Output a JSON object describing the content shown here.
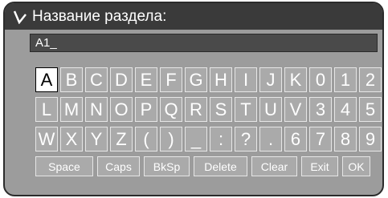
{
  "title": {
    "text": "Название раздела:",
    "icon": "chevron-down-icon"
  },
  "input": {
    "value": "A1_"
  },
  "keyboard": {
    "rows": [
      [
        "A",
        "B",
        "C",
        "D",
        "E",
        "F",
        "G",
        "H",
        "I",
        "J",
        "K",
        "0",
        "1",
        "2"
      ],
      [
        "L",
        "M",
        "N",
        "O",
        "P",
        "Q",
        "R",
        "S",
        "T",
        "U",
        "V",
        "3",
        "4",
        "5"
      ],
      [
        "W",
        "X",
        "Y",
        "Z",
        "(",
        ")",
        "_",
        ":",
        "?",
        ".",
        "6",
        "7",
        "8",
        "9"
      ]
    ],
    "selected": "A",
    "controls": [
      "Space",
      "Caps",
      "BkSp",
      "Delete",
      "Clear",
      "Exit",
      "OK"
    ]
  },
  "colors": {
    "panel_bg": "#9c9c9c",
    "title_bg": "#3a3a3a",
    "input_bg": "#4a4a4a",
    "key_bg": "#aaaaaa",
    "key_text": "#ffffff",
    "selected_bg": "#ffffff"
  }
}
